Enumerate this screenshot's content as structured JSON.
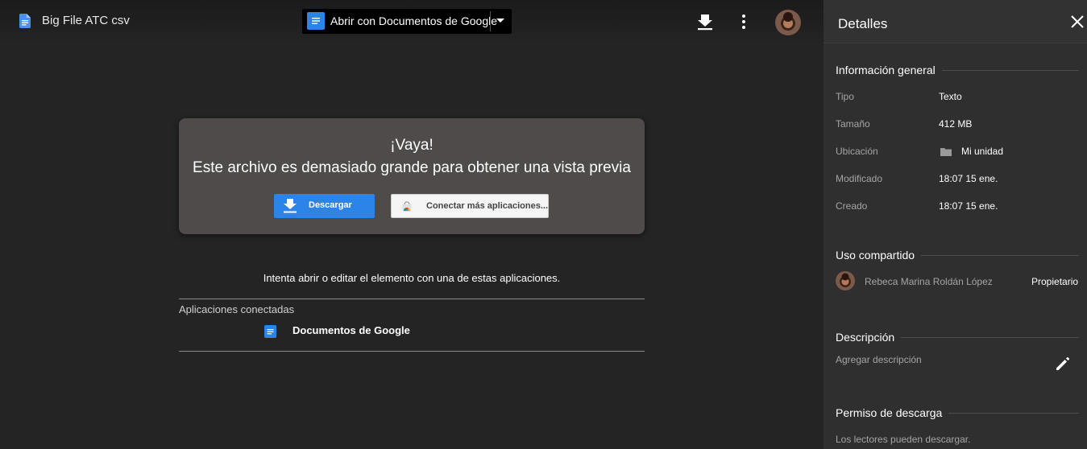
{
  "file": {
    "title": "Big File ATC csv"
  },
  "open_with": {
    "label": "Abrir con Documentos de Google"
  },
  "topbar_icons": [
    "download-icon",
    "more-vert-icon",
    "avatar"
  ],
  "preview": {
    "title": "¡Vaya!",
    "message": "Este archivo es demasiado grande para obtener una vista previa",
    "download_label": "Descargar",
    "connect_label": "Conectar más aplicaciones..."
  },
  "apps": {
    "try_text": "Intenta abrir o editar el elemento con una de estas aplicaciones.",
    "connected_label": "Aplicaciones conectadas",
    "items": [
      {
        "label": "Documentos de Google"
      }
    ]
  },
  "details": {
    "title": "Detalles",
    "general": {
      "heading": "Información general",
      "rows": [
        {
          "key": "Tipo",
          "value": "Texto"
        },
        {
          "key": "Tamaño",
          "value": "412 MB"
        },
        {
          "key": "Ubicación",
          "value": "Mi unidad"
        },
        {
          "key": "Modificado",
          "value": "18:07 15 ene."
        },
        {
          "key": "Creado",
          "value": "18:07 15 ene."
        }
      ]
    },
    "sharing": {
      "heading": "Uso compartido",
      "owner_name": "Rebeca Marina Roldán López",
      "owner_role": "Propietario"
    },
    "description": {
      "heading": "Descripción",
      "placeholder": "Agregar descripción"
    },
    "download_permission": {
      "heading": "Permiso de descarga",
      "text": "Los lectores pueden descargar."
    }
  },
  "colors": {
    "background": "#242424",
    "panel": "#2f2f2f",
    "card": "#4f4b4b",
    "accent_blue": "#2c84e8"
  }
}
